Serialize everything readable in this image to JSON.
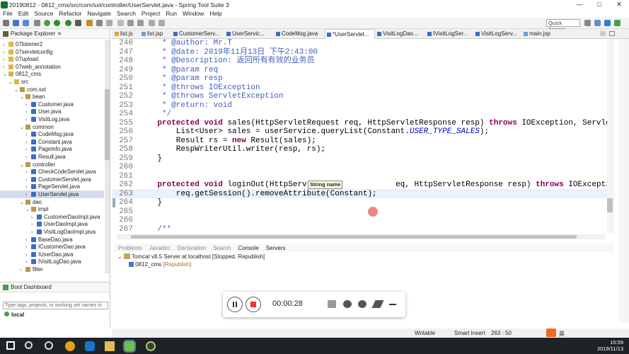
{
  "window": {
    "title": "20190812 - 0812_cms/src/com/sxt/controller/UserServlet.java - Spring Tool Suite 3",
    "minimize": "—",
    "maximize": "□",
    "close": "✕"
  },
  "menu": [
    "File",
    "Edit",
    "Source",
    "Refactor",
    "Navigate",
    "Search",
    "Project",
    "Run",
    "Window",
    "Help"
  ],
  "toolbar": {
    "quick_access": "Quick Access"
  },
  "package_explorer": {
    "title": "Package Explorer",
    "close": "✕",
    "items": [
      {
        "label": "07listener2"
      },
      {
        "label": "07servletconfig"
      },
      {
        "label": "07upload"
      },
      {
        "label": "07web_annotation"
      },
      {
        "label": "0812_cms"
      },
      {
        "label": "src"
      },
      {
        "label": "com.sxt"
      },
      {
        "label": "bean"
      },
      {
        "label": "Customer.java"
      },
      {
        "label": "User.java"
      },
      {
        "label": "VisitLog.java"
      },
      {
        "label": "common"
      },
      {
        "label": "CodeMsg.java"
      },
      {
        "label": "Constant.java"
      },
      {
        "label": "PageInfo.java"
      },
      {
        "label": "Result.java"
      },
      {
        "label": "controller"
      },
      {
        "label": "CheckCodeServlet.java"
      },
      {
        "label": "CustomerServlet.java"
      },
      {
        "label": "PageServlet.java"
      },
      {
        "label": "UserServlet.java"
      },
      {
        "label": "dao"
      },
      {
        "label": "impl"
      },
      {
        "label": "CustomerDaoImpl.java"
      },
      {
        "label": "UserDaoImpl.java"
      },
      {
        "label": "VisitLogDaoImpl.java"
      },
      {
        "label": "BaseDao.java"
      },
      {
        "label": "ICustomerDao.java"
      },
      {
        "label": "IUserDao.java"
      },
      {
        "label": "IVisitLogDao.java"
      },
      {
        "label": "filter"
      }
    ]
  },
  "boot_dashboard": {
    "title": "Boot Dashboard",
    "search_placeholder": "Type tags, projects, or working set names to",
    "local": "local"
  },
  "editor_tabs": [
    "list.js",
    "list.jsp",
    "CustomerServ...",
    "UserServic...",
    "CodeMsg.java",
    "*UserServlet...",
    "VisitLogDao...",
    "IVisitLogSer...",
    "VisitLogServ...",
    "main.jsp"
  ],
  "editor": {
    "lines": [
      {
        "n": "246",
        "text": "     * @author: Mr.T"
      },
      {
        "n": "247",
        "text": "     * @date: 2019年11月13日 下午2:43:00"
      },
      {
        "n": "248",
        "text": "     * @Description: 返回所有有效的业务员"
      },
      {
        "n": "249",
        "text": "     * @param req"
      },
      {
        "n": "250",
        "text": "     * @param resp"
      },
      {
        "n": "251",
        "text": "     * @throws IOException"
      },
      {
        "n": "252",
        "text": "     * @throws ServletException"
      },
      {
        "n": "253",
        "text": "     * @return: void"
      },
      {
        "n": "254",
        "text": "     */"
      },
      {
        "n": "255",
        "text": "    protected void sales(HttpServletRequest req, HttpServletResponse resp) throws IOException, ServletException {"
      },
      {
        "n": "256",
        "text": "        List<User> sales = userService.queryList(Constant.USER_TYPE_SALES);"
      },
      {
        "n": "257",
        "text": "        Result rs = new Result(sales);"
      },
      {
        "n": "258",
        "text": "        RespWriterUtil.writer(resp, rs);"
      },
      {
        "n": "259",
        "text": "    }"
      },
      {
        "n": "260",
        "text": ""
      },
      {
        "n": "261",
        "text": ""
      },
      {
        "n": "262",
        "text": "    protected void loginOut(HttpServletRe              eq, HttpServletResponse resp) throws IOException, ServletException {"
      },
      {
        "n": "263",
        "text": "        req.getSession().removeAttribute(Constant);"
      },
      {
        "n": "264",
        "text": "    }"
      },
      {
        "n": "265",
        "text": ""
      },
      {
        "n": "266",
        "text": ""
      },
      {
        "n": "267",
        "text": "    /**"
      }
    ],
    "tooltip": "String name"
  },
  "bottom_tabs": [
    "Problems",
    "Javadoc",
    "Declaration",
    "Search",
    "Console",
    "Servers"
  ],
  "servers": {
    "server": "Tomcat v8.5 Server at localhost  [Stopped, Republish]",
    "module": "0812_cms",
    "module_state": "[Republish]"
  },
  "recorder": {
    "time": "00:00:28"
  },
  "status": {
    "mode": "Writable",
    "insert": "Smart Insert",
    "position": "263 : 50"
  },
  "taskbar": {
    "time": "15:59",
    "date": "2019/11/13",
    "ime": "英"
  },
  "colors": {
    "keyword": "#7f0055",
    "comment": "#3f5fbf",
    "static_field": "#0000c0",
    "selection": "#d5dcef"
  }
}
